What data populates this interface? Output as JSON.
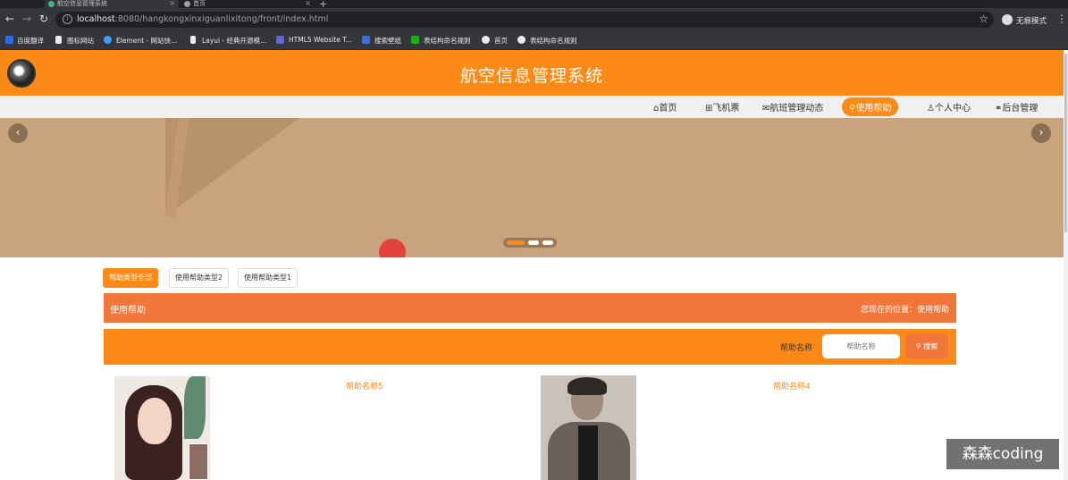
{
  "browser": {
    "tabs": [
      {
        "title": "航空信息管理系统",
        "favicon_color": "#41b883"
      },
      {
        "title": "首页",
        "favicon_color": "#9aa0a6"
      }
    ],
    "url_host": "localhost",
    "url_rest": ":8080/hangkongxinxiguanlixitong/front/index.html",
    "profile_label": "无痕模式",
    "bookmarks": [
      {
        "label": "百度翻译",
        "color": "#2b6de6"
      },
      {
        "label": "图标网站",
        "color": "#e8eaed"
      },
      {
        "label": "Element - 网站快...",
        "color": "#409eff"
      },
      {
        "label": "Layui - 经典开源模...",
        "color": "#e8eaed"
      },
      {
        "label": "HTML5 Website T...",
        "color": "#5b6bd8"
      },
      {
        "label": "搜索壁纸",
        "color": "#3d6fd8"
      },
      {
        "label": "表结构命名规则",
        "color": "#1aad19"
      },
      {
        "label": "首页",
        "color": "#e8eaed"
      },
      {
        "label": "表结构命名规则",
        "color": "#e8eaed"
      }
    ]
  },
  "header": {
    "title": "航空信息管理系统"
  },
  "nav": {
    "items": [
      {
        "label": "首页",
        "icon": "home-icon"
      },
      {
        "label": "飞机票",
        "icon": "ticket-icon"
      },
      {
        "label": "航班管理动态",
        "icon": "mail-icon"
      },
      {
        "label": "使用帮助",
        "icon": "pin-icon",
        "active": true
      },
      {
        "label": "个人中心",
        "icon": "user-icon"
      },
      {
        "label": "后台管理",
        "icon": "link-icon"
      }
    ]
  },
  "categories": [
    {
      "label": "帮助类型全部",
      "active": true
    },
    {
      "label": "使用帮助类型2",
      "active": false
    },
    {
      "label": "使用帮助类型1",
      "active": false
    }
  ],
  "location": {
    "title": "使用帮助",
    "path": "您现在的位置：使用帮助"
  },
  "search": {
    "label": "帮助名称",
    "placeholder": "帮助名称",
    "button": "搜索"
  },
  "cards": [
    {
      "title": "帮助名称5"
    },
    {
      "title": "帮助名称4"
    }
  ],
  "watermark": "森森coding",
  "colors": {
    "primary": "#fd8a16",
    "secondary": "#f0763a",
    "banner": "#c8a37d"
  }
}
